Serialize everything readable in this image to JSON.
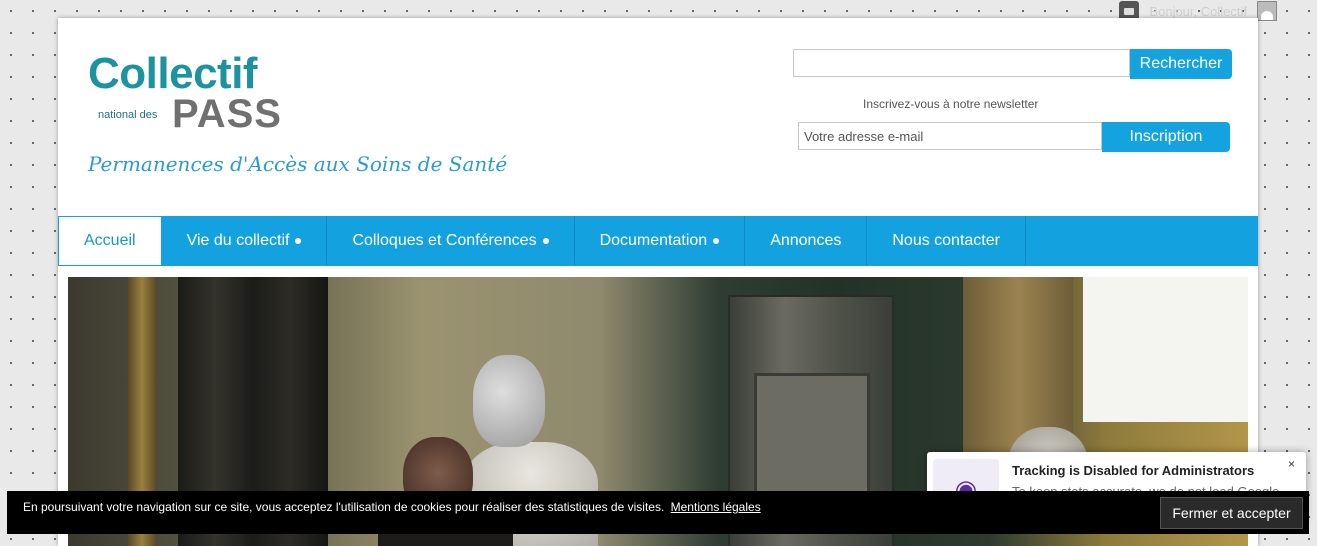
{
  "adminbar": {
    "greeting": "Bonjour, Collectif",
    "comment_icon": "comment-icon",
    "avatar_icon": "user-avatar-icon"
  },
  "logo": {
    "wordmark": "Collectif",
    "national": "national des",
    "pass": "PASS",
    "tagline": "Permanences d'Accès aux Soins de Santé"
  },
  "search": {
    "input_value": "",
    "placeholder": "",
    "button_label": "Rechercher"
  },
  "newsletter": {
    "title": "Inscrivez-vous à notre newsletter",
    "placeholder": "Votre adresse e-mail",
    "button_label": "Inscription"
  },
  "nav": {
    "items": [
      {
        "label": "Accueil",
        "active": true,
        "has_submenu": false
      },
      {
        "label": "Vie du collectif",
        "active": false,
        "has_submenu": true
      },
      {
        "label": "Colloques et Conférences",
        "active": false,
        "has_submenu": true
      },
      {
        "label": "Documentation",
        "active": false,
        "has_submenu": true
      },
      {
        "label": "Annonces",
        "active": false,
        "has_submenu": false
      },
      {
        "label": "Nous contacter",
        "active": false,
        "has_submenu": false
      }
    ]
  },
  "tracking_notice": {
    "title": "Tracking is Disabled for Administrators",
    "text": "To keep stats accurate, we do not load Google",
    "close": "×",
    "icon": "tracking-icon"
  },
  "cookie_banner": {
    "text": "En poursuivant votre navigation sur ce site, vous acceptez l'utilisation de cookies pour réaliser des statistiques de visites.",
    "link_label": "Mentions légales",
    "button_label": "Fermer et accepter"
  },
  "colors": {
    "brand_blue": "#13a2df",
    "logo_teal": "#1d93a2",
    "logo_gray": "#707070",
    "tagline_blue": "#2b9bd6"
  }
}
